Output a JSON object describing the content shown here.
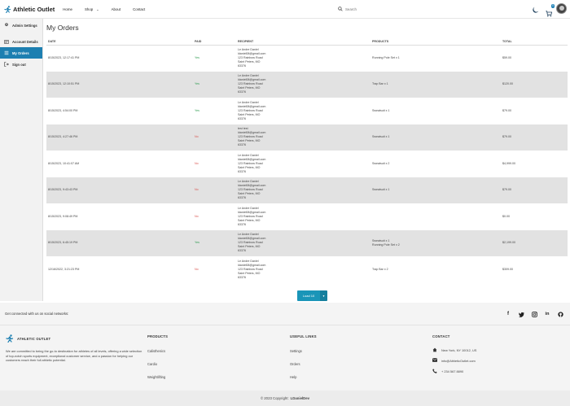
{
  "brand": {
    "name": "Athletic Outlet"
  },
  "nav": {
    "home": "Home",
    "shop": "Shop",
    "about": "About",
    "contact": "Contact"
  },
  "search": {
    "placeholder": "Search"
  },
  "cart": {
    "count": "0"
  },
  "sidebar": {
    "items": [
      {
        "label": "Admin Settings",
        "icon": "gear-icon"
      },
      {
        "label": "Account Details",
        "icon": "id-card-icon"
      },
      {
        "label": "My Orders",
        "icon": "list-icon"
      },
      {
        "label": "Sign out",
        "icon": "sign-out-icon"
      }
    ]
  },
  "page": {
    "title": "My Orders"
  },
  "orders": {
    "columns": [
      "DATE",
      "PAID",
      "RECIPIENT",
      "PRODUCTS",
      "TOTAL"
    ],
    "rows": [
      {
        "date": "8/15/2023, 12:17:41 PM",
        "paid": "Yes",
        "paid_flag": true,
        "recipient": [
          "Le Andre Daniel",
          "ldaniel08@gmail.com",
          "123 Rainbow Road",
          "Saint Peters, MO",
          "63376"
        ],
        "products": [
          "Running Pole Set x 1"
        ],
        "total": "$59.00"
      },
      {
        "date": "8/15/2023, 12:10:51 PM",
        "paid": "Yes",
        "paid_flag": true,
        "recipient": [
          "Le Andre Daniel",
          "ldaniel08@gmail.com",
          "123 Rainbow Road",
          "Saint Peters, MO",
          "63376"
        ],
        "products": [
          "Trap Bar x 1"
        ],
        "total": "$120.00"
      },
      {
        "date": "8/15/2023, 4:54:00 PM",
        "paid": "Yes",
        "paid_flag": true,
        "recipient": [
          "Le Andre Daniel",
          "ldaniel08@gmail.com",
          "123 Rainbow Road",
          "Saint Peters, MO",
          "63376"
        ],
        "products": [
          "Sweatsuit x 1"
        ],
        "total": "$79.00"
      },
      {
        "date": "8/15/2023, 4:27:46 PM",
        "paid": "No",
        "paid_flag": false,
        "recipient": [
          "test test",
          "ldaniel08@gmail.com",
          "123 Rainbow Road",
          "Saint Peters, MO",
          "63376"
        ],
        "products": [
          "Sweatsuit x 1"
        ],
        "total": "$79.00"
      },
      {
        "date": "8/15/2023, 10:41:07 AM",
        "paid": "No",
        "paid_flag": false,
        "recipient": [
          "Le Andre Daniel",
          "ldaniel08@gmail.com",
          "123 Rainbow Road",
          "Saint Peters, MO",
          "63376"
        ],
        "products": [
          "Sweatsuit x 2"
        ],
        "total": "$4,999.00"
      },
      {
        "date": "8/15/2023, 9:43:43 PM",
        "paid": "No",
        "paid_flag": false,
        "recipient": [
          "Le Andre Daniel",
          "ldaniel08@gmail.com",
          "123 Rainbow Road",
          "Saint Peters, MO",
          "63376"
        ],
        "products": [
          "Sweatsuit x 1"
        ],
        "total": "$79.00"
      },
      {
        "date": "8/15/2023, 9:08:49 PM",
        "paid": "No",
        "paid_flag": false,
        "recipient": [
          "Le Andre Daniel",
          "ldaniel08@gmail.com",
          "123 Rainbow Road",
          "Saint Peters, MO",
          "63376"
        ],
        "products": [],
        "total": "$0.00"
      },
      {
        "date": "8/15/2023, 6:45:19 PM",
        "paid": "Yes",
        "paid_flag": true,
        "recipient": [
          "Le Andre Daniel",
          "ldaniel08@gmail.com",
          "123 Rainbow Road",
          "Saint Peters, MO",
          "63376"
        ],
        "products": [
          "Sweatsuit x 1",
          "Running Pole Set x 2"
        ],
        "total": "$2,199.00"
      },
      {
        "date": "12/16/2022, 3:21:23 PM",
        "paid": "No",
        "paid_flag": false,
        "recipient": [
          "Le Andre Daniel",
          "ldaniel08@gmail.com",
          "123 Rainbow Road",
          "Saint Peters, MO",
          "63376"
        ],
        "products": [
          "Trap Bar x 2"
        ],
        "total": "$309.00"
      }
    ]
  },
  "load_more": {
    "label": "Load 10",
    "caret": "▾"
  },
  "social": {
    "text": "Get connected with us on social networks:"
  },
  "footer": {
    "brand": "ATHLETIC OUTLET",
    "description": "We are committed to being the go-to destination for athletes of all levels, offering a wide selection of top-notch sports equipment, exceptional customer service, and a passion for helping our customers reach their full athletic potential.",
    "products_heading": "PRODUCTS",
    "products": [
      "Calisthenics",
      "Cardio",
      "Weightlifting"
    ],
    "useful_heading": "USEFUL LINKS",
    "useful": [
      "Settings",
      "Orders",
      "Help"
    ],
    "contact_heading": "CONTACT",
    "contact": [
      "New York, NY 10012, US",
      "info@AthleticOutlet.com",
      "+ 234 567 8890"
    ]
  },
  "copyright": {
    "text": "© 2023 Copyright:",
    "owner": "LDanielDev"
  },
  "colors": {
    "accent": "#1d7fb1",
    "paid_yes": "#2e9b4f",
    "paid_no": "#d9534f"
  }
}
